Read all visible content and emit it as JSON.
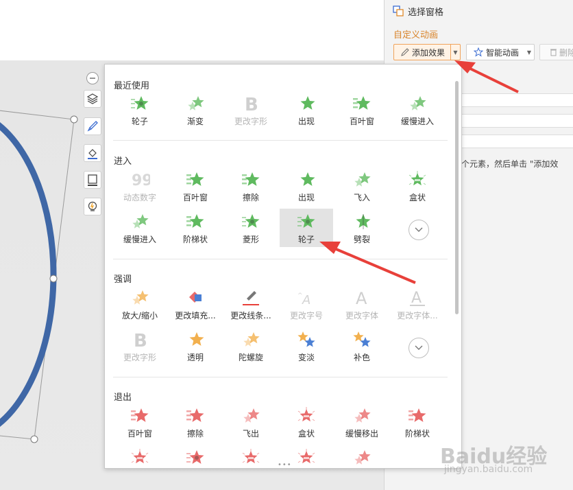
{
  "task_pane": {
    "header": "选择窗格",
    "section_title": "自定义动画",
    "add_effect_label": "添加效果",
    "smart_anim_label": "智能动画",
    "delete_label": "删除",
    "hint_text": "个元素，然后单击 \"添加效"
  },
  "gallery": {
    "categories": {
      "recent": "最近使用",
      "enter": "进入",
      "emphasis": "强调",
      "exit": "退出"
    },
    "recent": [
      "轮子",
      "渐变",
      "更改字形",
      "出现",
      "百叶窗",
      "缓慢进入"
    ],
    "enter_row1": [
      "动态数字",
      "百叶窗",
      "擦除",
      "出现",
      "飞入",
      "盒状"
    ],
    "enter_row2": [
      "缓慢进入",
      "阶梯状",
      "菱形",
      "轮子",
      "劈裂"
    ],
    "emphasis_row1": [
      "放大/缩小",
      "更改填充...",
      "更改线条...",
      "更改字号",
      "更改字体",
      "更改字体..."
    ],
    "emphasis_row2": [
      "更改字形",
      "透明",
      "陀螺旋",
      "变淡",
      "补色"
    ],
    "exit_row1": [
      "百叶窗",
      "擦除",
      "飞出",
      "盒状",
      "缓慢移出",
      "阶梯状"
    ],
    "selected": "轮子"
  },
  "watermark": {
    "brand": "Baidu经验",
    "url": "jingyan.baidu.com"
  },
  "colors": {
    "accent_orange": "#d9852c",
    "enter_green": "#5fba5f",
    "emphasis_orange": "#f2b04e",
    "exit_red": "#e86a6a",
    "arrow_red": "#e8403a",
    "ellipse_blue": "#3f67a6"
  }
}
